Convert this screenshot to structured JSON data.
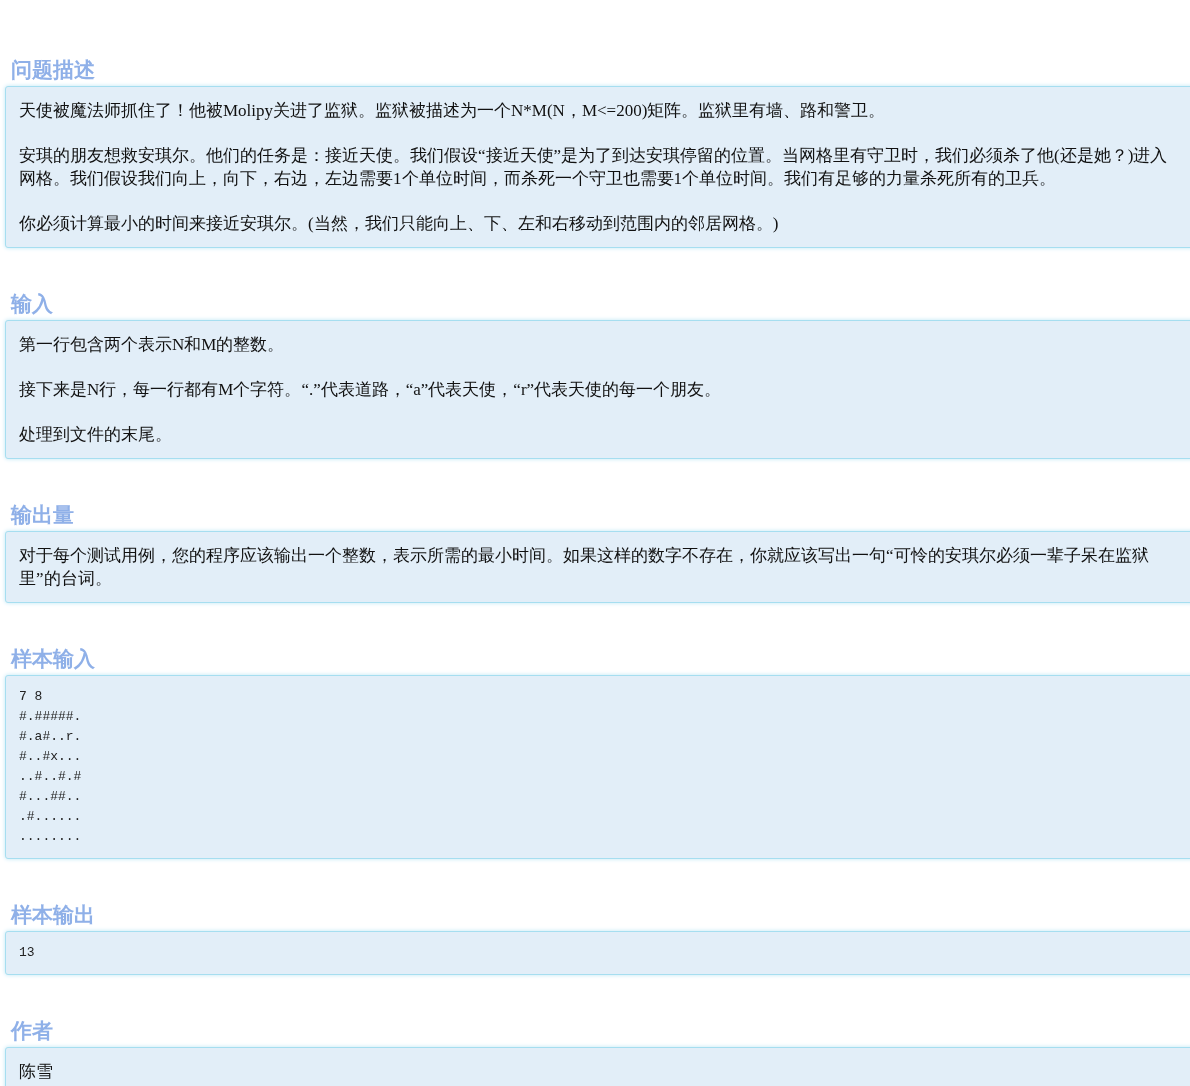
{
  "sections": [
    {
      "heading": "问题描述",
      "kind": "text",
      "paragraphs": [
        "天使被魔法师抓住了！他被Molipy关进了监狱。监狱被描述为一个N*M(N，M<=200)矩阵。监狱里有墙、路和警卫。",
        "安琪的朋友想救安琪尔。他们的任务是：接近天使。我们假设“接近天使”是为了到达安琪停留的位置。当网格里有守卫时，我们必须杀了他(还是她？)进入网格。我们假设我们向上，向下，右边，左边需要1个单位时间，而杀死一个守卫也需要1个单位时间。我们有足够的力量杀死所有的卫兵。",
        "你必须计算最小的时间来接近安琪尔。(当然，我们只能向上、下、左和右移动到范围内的邻居网格。)"
      ]
    },
    {
      "heading": "输入",
      "kind": "text",
      "paragraphs": [
        "第一行包含两个表示N和M的整数。",
        "接下来是N行，每一行都有M个字符。“.”代表道路，“a”代表天使，“r”代表天使的每一个朋友。",
        "处理到文件的末尾。"
      ]
    },
    {
      "heading": "输出量",
      "kind": "text",
      "paragraphs": [
        "对于每个测试用例，您的程序应该输出一个整数，表示所需的最小时间。如果这样的数字不存在，你就应该写出一句“可怜的安琪尔必须一辈子呆在监狱里”的台词。"
      ]
    },
    {
      "heading": "样本输入",
      "kind": "code",
      "lines": [
        "7 8",
        "#.#####.",
        "#.a#..r.",
        "#..#x...",
        "..#..#.#",
        "#...##..",
        ".#......",
        "........"
      ]
    },
    {
      "heading": "样本输出",
      "kind": "code",
      "lines": [
        "13"
      ]
    },
    {
      "heading": "作者",
      "kind": "text",
      "paragraphs": [
        "陈雪"
      ]
    }
  ]
}
